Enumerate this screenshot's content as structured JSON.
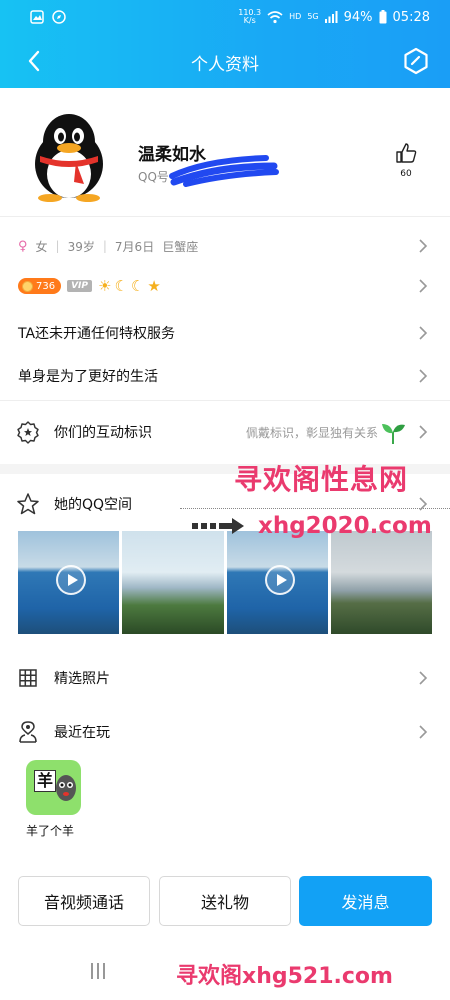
{
  "status_bar": {
    "net_speed_value": "110.3",
    "net_speed_unit": "K/s",
    "hd": "HD",
    "sg": "5G",
    "battery": "94%",
    "time": "05:28"
  },
  "nav": {
    "title": "个人资料"
  },
  "profile": {
    "name": "温柔如水",
    "qq_prefix": "QQ号",
    "likes": "60"
  },
  "info": {
    "gender": "女",
    "age": "39岁",
    "birthday": "7月6日",
    "zodiac": "巨蟹座"
  },
  "badges": {
    "level": "736",
    "vip": "VIP"
  },
  "privilege_text": "TA还未开通任何特权服务",
  "signature": "单身是为了更好的生活",
  "interaction": {
    "label": "你们的互动标识",
    "hint": "佩戴标识，彰显独有关系"
  },
  "qzone": {
    "label": "她的QQ空间"
  },
  "featured_photos": {
    "label": "精选照片"
  },
  "recent_games": {
    "label": "最近在玩",
    "game_name": "羊了个羊",
    "game_icon_char": "羊"
  },
  "buttons": {
    "call": "音视频通话",
    "gift": "送礼物",
    "message": "发消息"
  },
  "watermark": {
    "line1": "寻欢阁性息网",
    "line2": "xhg2020.com",
    "bottom": "寻欢阁xhg521.com"
  },
  "colors": {
    "header_gradient_start": "#17c2f3",
    "header_gradient_end": "#1a9ef6",
    "primary_button": "#12a1f5",
    "watermark": "#ea3a6e",
    "level_badge": "#ff7a1a"
  }
}
